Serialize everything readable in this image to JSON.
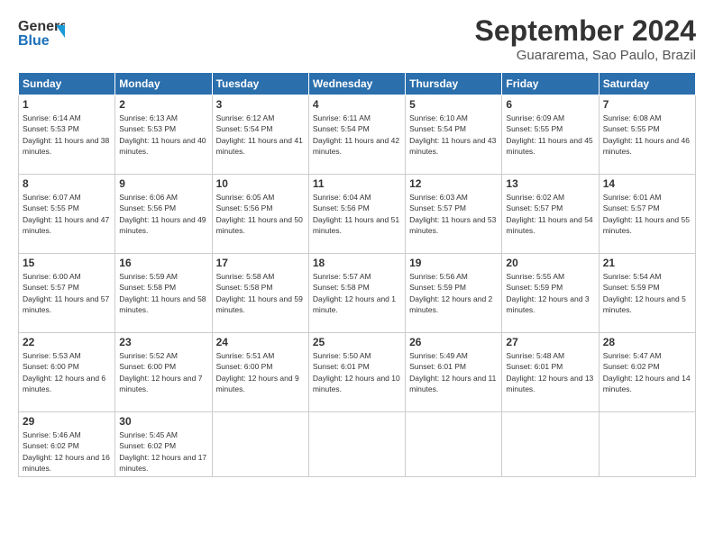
{
  "header": {
    "logo_line1": "General",
    "logo_line2": "Blue",
    "month": "September 2024",
    "location": "Guararema, Sao Paulo, Brazil"
  },
  "weekdays": [
    "Sunday",
    "Monday",
    "Tuesday",
    "Wednesday",
    "Thursday",
    "Friday",
    "Saturday"
  ],
  "weeks": [
    [
      {
        "day": "1",
        "sunrise": "6:14 AM",
        "sunset": "5:53 PM",
        "daylight": "11 hours and 38 minutes."
      },
      {
        "day": "2",
        "sunrise": "6:13 AM",
        "sunset": "5:53 PM",
        "daylight": "11 hours and 40 minutes."
      },
      {
        "day": "3",
        "sunrise": "6:12 AM",
        "sunset": "5:54 PM",
        "daylight": "11 hours and 41 minutes."
      },
      {
        "day": "4",
        "sunrise": "6:11 AM",
        "sunset": "5:54 PM",
        "daylight": "11 hours and 42 minutes."
      },
      {
        "day": "5",
        "sunrise": "6:10 AM",
        "sunset": "5:54 PM",
        "daylight": "11 hours and 43 minutes."
      },
      {
        "day": "6",
        "sunrise": "6:09 AM",
        "sunset": "5:55 PM",
        "daylight": "11 hours and 45 minutes."
      },
      {
        "day": "7",
        "sunrise": "6:08 AM",
        "sunset": "5:55 PM",
        "daylight": "11 hours and 46 minutes."
      }
    ],
    [
      {
        "day": "8",
        "sunrise": "6:07 AM",
        "sunset": "5:55 PM",
        "daylight": "11 hours and 47 minutes."
      },
      {
        "day": "9",
        "sunrise": "6:06 AM",
        "sunset": "5:56 PM",
        "daylight": "11 hours and 49 minutes."
      },
      {
        "day": "10",
        "sunrise": "6:05 AM",
        "sunset": "5:56 PM",
        "daylight": "11 hours and 50 minutes."
      },
      {
        "day": "11",
        "sunrise": "6:04 AM",
        "sunset": "5:56 PM",
        "daylight": "11 hours and 51 minutes."
      },
      {
        "day": "12",
        "sunrise": "6:03 AM",
        "sunset": "5:57 PM",
        "daylight": "11 hours and 53 minutes."
      },
      {
        "day": "13",
        "sunrise": "6:02 AM",
        "sunset": "5:57 PM",
        "daylight": "11 hours and 54 minutes."
      },
      {
        "day": "14",
        "sunrise": "6:01 AM",
        "sunset": "5:57 PM",
        "daylight": "11 hours and 55 minutes."
      }
    ],
    [
      {
        "day": "15",
        "sunrise": "6:00 AM",
        "sunset": "5:57 PM",
        "daylight": "11 hours and 57 minutes."
      },
      {
        "day": "16",
        "sunrise": "5:59 AM",
        "sunset": "5:58 PM",
        "daylight": "11 hours and 58 minutes."
      },
      {
        "day": "17",
        "sunrise": "5:58 AM",
        "sunset": "5:58 PM",
        "daylight": "11 hours and 59 minutes."
      },
      {
        "day": "18",
        "sunrise": "5:57 AM",
        "sunset": "5:58 PM",
        "daylight": "12 hours and 1 minute."
      },
      {
        "day": "19",
        "sunrise": "5:56 AM",
        "sunset": "5:59 PM",
        "daylight": "12 hours and 2 minutes."
      },
      {
        "day": "20",
        "sunrise": "5:55 AM",
        "sunset": "5:59 PM",
        "daylight": "12 hours and 3 minutes."
      },
      {
        "day": "21",
        "sunrise": "5:54 AM",
        "sunset": "5:59 PM",
        "daylight": "12 hours and 5 minutes."
      }
    ],
    [
      {
        "day": "22",
        "sunrise": "5:53 AM",
        "sunset": "6:00 PM",
        "daylight": "12 hours and 6 minutes."
      },
      {
        "day": "23",
        "sunrise": "5:52 AM",
        "sunset": "6:00 PM",
        "daylight": "12 hours and 7 minutes."
      },
      {
        "day": "24",
        "sunrise": "5:51 AM",
        "sunset": "6:00 PM",
        "daylight": "12 hours and 9 minutes."
      },
      {
        "day": "25",
        "sunrise": "5:50 AM",
        "sunset": "6:01 PM",
        "daylight": "12 hours and 10 minutes."
      },
      {
        "day": "26",
        "sunrise": "5:49 AM",
        "sunset": "6:01 PM",
        "daylight": "12 hours and 11 minutes."
      },
      {
        "day": "27",
        "sunrise": "5:48 AM",
        "sunset": "6:01 PM",
        "daylight": "12 hours and 13 minutes."
      },
      {
        "day": "28",
        "sunrise": "5:47 AM",
        "sunset": "6:02 PM",
        "daylight": "12 hours and 14 minutes."
      }
    ],
    [
      {
        "day": "29",
        "sunrise": "5:46 AM",
        "sunset": "6:02 PM",
        "daylight": "12 hours and 16 minutes."
      },
      {
        "day": "30",
        "sunrise": "5:45 AM",
        "sunset": "6:02 PM",
        "daylight": "12 hours and 17 minutes."
      },
      null,
      null,
      null,
      null,
      null
    ]
  ]
}
